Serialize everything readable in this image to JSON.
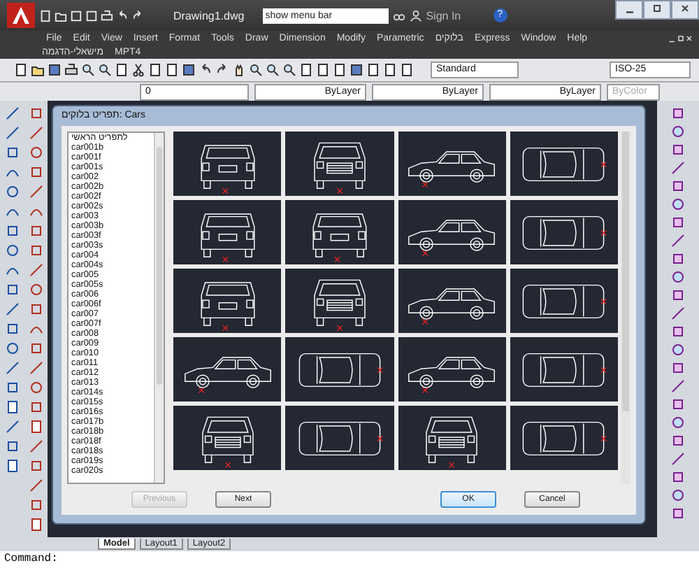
{
  "title_bar": {
    "file_name": "Drawing1.dwg",
    "search": {
      "value": "show menu bar"
    },
    "sign_in": "Sign In",
    "help": "?"
  },
  "menu_bar": {
    "items": [
      "File",
      "Edit",
      "View",
      "Insert",
      "Format",
      "Tools",
      "Draw",
      "Dimension",
      "Modify",
      "Parametric",
      "בלוקים",
      "Express",
      "Window",
      "Help"
    ],
    "second_row": [
      "מישאלי-הדגמה",
      "MPT4"
    ]
  },
  "toolbar": {
    "text_style": "Standard",
    "dim_style": "ISO-25"
  },
  "layers_bar": {
    "layer": "0",
    "color_setting": "ByLayer",
    "linetype": "ByLayer",
    "lineweight": "ByLayer",
    "plot_style": {
      "value": "ByColor",
      "disabled": true
    }
  },
  "dialog": {
    "title": "תפריט בלוקים: Cars",
    "list": [
      {
        "label": "לתפריט הראשי",
        "selected": false
      },
      {
        "label": "car001b",
        "selected": false
      },
      {
        "label": "car001f",
        "selected": false
      },
      {
        "label": "car001s",
        "selected": false
      },
      {
        "label": "car002",
        "selected": false
      },
      {
        "label": "car002b",
        "selected": false
      },
      {
        "label": "car002f",
        "selected": false
      },
      {
        "label": "car002s",
        "selected": false
      },
      {
        "label": "car003",
        "selected": false
      },
      {
        "label": "car003b",
        "selected": false
      },
      {
        "label": "car003f",
        "selected": false
      },
      {
        "label": "car003s",
        "selected": false
      },
      {
        "label": "car004",
        "selected": false
      },
      {
        "label": "car004s",
        "selected": false
      },
      {
        "label": "car005",
        "selected": false
      },
      {
        "label": "car005s",
        "selected": false
      },
      {
        "label": "car006",
        "selected": false
      },
      {
        "label": "car006f",
        "selected": false
      },
      {
        "label": "car007",
        "selected": false
      },
      {
        "label": "car007f",
        "selected": false
      },
      {
        "label": "car008",
        "selected": false
      },
      {
        "label": "car009",
        "selected": false
      },
      {
        "label": "car010",
        "selected": false
      },
      {
        "label": "car011",
        "selected": false
      },
      {
        "label": "car012",
        "selected": false
      },
      {
        "label": "car013",
        "selected": false
      },
      {
        "label": "car014s",
        "selected": false
      },
      {
        "label": "car015s",
        "selected": false
      },
      {
        "label": "car016s",
        "selected": false
      },
      {
        "label": "car017b",
        "selected": false
      },
      {
        "label": "car018b",
        "selected": false
      },
      {
        "label": "car018f",
        "selected": false
      },
      {
        "label": "car018s",
        "selected": false
      },
      {
        "label": "car019s",
        "selected": false
      },
      {
        "label": "car020s",
        "selected": false
      }
    ],
    "tiles": [
      {
        "kind": "rear"
      },
      {
        "kind": "front"
      },
      {
        "kind": "side"
      },
      {
        "kind": "top"
      },
      {
        "kind": "rear"
      },
      {
        "kind": "rear"
      },
      {
        "kind": "side"
      },
      {
        "kind": "top"
      },
      {
        "kind": "rear"
      },
      {
        "kind": "front"
      },
      {
        "kind": "side"
      },
      {
        "kind": "top"
      },
      {
        "kind": "side"
      },
      {
        "kind": "top"
      },
      {
        "kind": "side"
      },
      {
        "kind": "top"
      },
      {
        "kind": "front"
      },
      {
        "kind": "top"
      },
      {
        "kind": "front"
      },
      {
        "kind": "top"
      }
    ],
    "buttons": [
      {
        "label": "Previous",
        "disabled": true,
        "default": false
      },
      {
        "label": "Next",
        "disabled": false,
        "default": false
      },
      {
        "label": "OK",
        "disabled": false,
        "default": true
      },
      {
        "label": "Cancel",
        "disabled": false,
        "default": false
      }
    ]
  },
  "layout_tabs": [
    {
      "label": "Model",
      "selected": true
    },
    {
      "label": "Layout1",
      "selected": false
    },
    {
      "label": "Layout2",
      "selected": false
    }
  ],
  "command_line": {
    "prompt": "Command:"
  }
}
